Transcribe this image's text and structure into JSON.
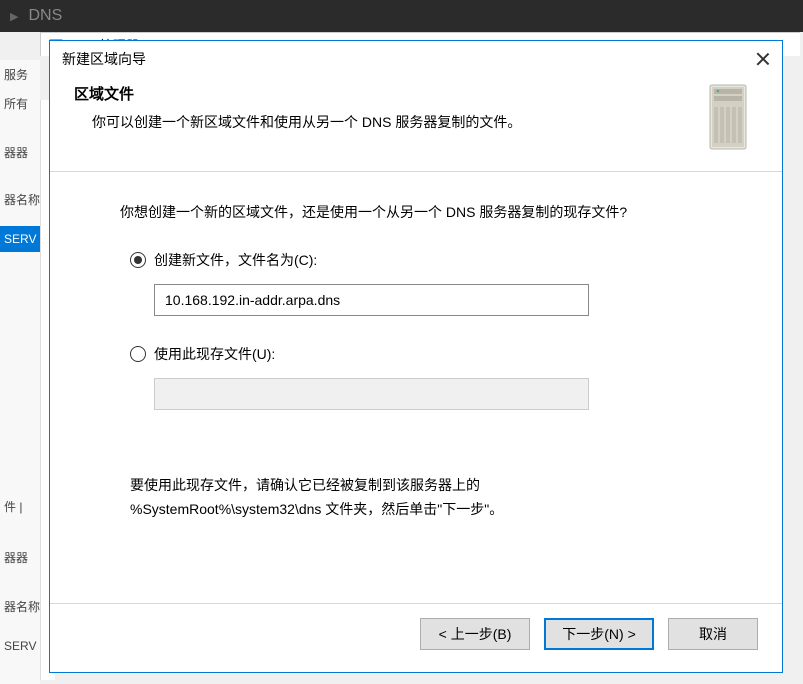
{
  "background": {
    "app_title": "DNS",
    "window_title": "DNS 管理器",
    "sidebar": {
      "items": [
        "服务",
        "所有",
        "器器",
        "器名称",
        "SERV",
        "件 |",
        "器器",
        "器名称",
        "SERV"
      ]
    }
  },
  "dialog": {
    "title": "新建区域向导",
    "header": {
      "title": "区域文件",
      "description": "你可以创建一个新区域文件和使用从另一个 DNS 服务器复制的文件。"
    },
    "content": {
      "question": "你想创建一个新的区域文件，还是使用一个从另一个 DNS 服务器复制的现存文件?",
      "option_create": {
        "label": "创建新文件，文件名为(C):",
        "value": "10.168.192.in-addr.arpa.dns",
        "checked": true
      },
      "option_existing": {
        "label": "使用此现存文件(U):",
        "value": "",
        "checked": false
      },
      "note_line1": "要使用此现存文件，请确认它已经被复制到该服务器上的",
      "note_line2": "%SystemRoot%\\system32\\dns 文件夹，然后单击\"下一步\"。"
    },
    "buttons": {
      "back": "< 上一步(B)",
      "next": "下一步(N) >",
      "cancel": "取消"
    }
  }
}
